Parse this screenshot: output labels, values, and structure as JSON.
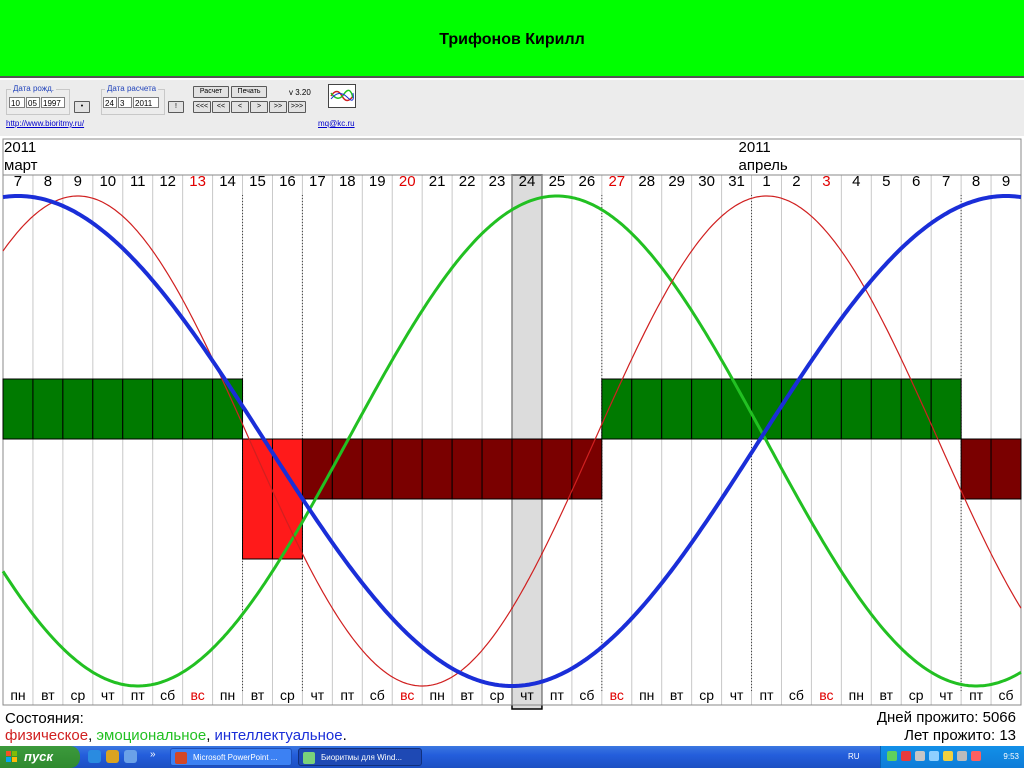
{
  "window": {
    "title": "Трифонов Кирилл"
  },
  "toolbar": {
    "birth_label": "Дата рожд.",
    "birth_day": "10",
    "birth_month": "05",
    "birth_year": "1997",
    "birth_btn": "•",
    "calc_label": "Дата расчета",
    "calc_day": "24",
    "calc_month": "3",
    "calc_year": "2011",
    "calc_btn": "!",
    "calc_button": "Расчет",
    "print_button": "Печать",
    "version": "v 3.20",
    "nav": [
      "<<<",
      "<<",
      "<",
      ">",
      ">>",
      ">>>"
    ],
    "site_link": "http://www.bioritmy.ru/",
    "mail_link": "mq@kc.ru"
  },
  "chart": {
    "months": [
      {
        "year": "2011",
        "name": "март",
        "col": 0
      },
      {
        "year": "2011",
        "name": "апрель",
        "col": 25
      }
    ],
    "days": [
      "7",
      "8",
      "9",
      "10",
      "11",
      "12",
      "13",
      "14",
      "15",
      "16",
      "17",
      "18",
      "19",
      "20",
      "21",
      "22",
      "23",
      "24",
      "25",
      "26",
      "27",
      "28",
      "29",
      "30",
      "31",
      "1",
      "2",
      "3",
      "4",
      "5",
      "6",
      "7",
      "8",
      "9"
    ],
    "weekdays": [
      "пн",
      "вт",
      "ср",
      "чт",
      "пт",
      "сб",
      "вс",
      "пн",
      "вт",
      "ср",
      "чт",
      "пт",
      "сб",
      "вс",
      "пн",
      "вт",
      "ср",
      "чт",
      "пт",
      "сб",
      "вс",
      "пн",
      "вт",
      "ср",
      "чт",
      "пт",
      "сб",
      "вс",
      "пн",
      "вт",
      "ср",
      "чт",
      "пт",
      "сб"
    ],
    "highlight_index": 17,
    "holiday_color": "#e00000",
    "text_color": "#000000",
    "physical_color": "#d02020",
    "emotional_color": "#22c022",
    "intellectual_color": "#1a2ed8",
    "good_color": "#007a00",
    "bad_color": "#7a0000",
    "critical_color": "#ff1a1a",
    "highlight_color": "#dcdcdc",
    "physical_period_days": 23,
    "emotional_period_days": 28,
    "intellectual_period_days": 33,
    "physical_peak_index": 2,
    "emotional_peak_index": 18,
    "intellectual_peak_index": 33,
    "state_bars": [
      {
        "from": 0,
        "to": 7,
        "level": "good"
      },
      {
        "from": 8,
        "to": 9,
        "level": "critical"
      },
      {
        "from": 10,
        "to": 19,
        "level": "bad"
      },
      {
        "from": 20,
        "to": 31,
        "level": "good"
      },
      {
        "from": 32,
        "to": 33,
        "level": "bad"
      }
    ],
    "dotted_lines": [
      8,
      10,
      20,
      25,
      32
    ]
  },
  "footer": {
    "states_label": "Состояния:",
    "physical": "физическое",
    "emotional": "эмоциональное",
    "intellectual": "интеллектуальное",
    "sep": ",",
    "end": ".",
    "days_lived": "Дней прожито: 5066",
    "years_lived": "Лет прожито: 13"
  },
  "taskbar": {
    "start": "пуск",
    "chevron": "»",
    "task1": "Microsoft PowerPoint ...",
    "task2": "Биоритмы для Wind...",
    "lang": "RU",
    "clock": "9:53"
  }
}
